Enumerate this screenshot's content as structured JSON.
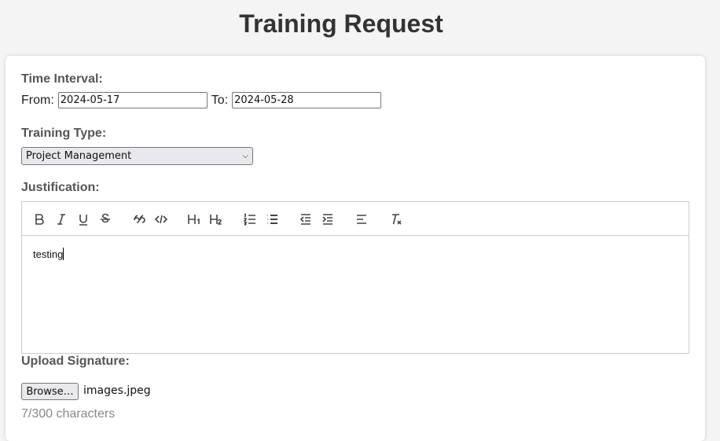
{
  "page": {
    "title": "Training Request"
  },
  "time_interval": {
    "label": "Time Interval:",
    "from_label": "From:",
    "from_value": "2024-05-17",
    "to_label": "To:",
    "to_value": "2024-05-28"
  },
  "training_type": {
    "label": "Training Type:",
    "selected": "Project Management"
  },
  "justification": {
    "label": "Justification:",
    "toolbar": [
      "bold",
      "italic",
      "underline",
      "strikethrough",
      "blockquote",
      "code-block",
      "header-1",
      "header-2",
      "ordered-list",
      "bullet-list",
      "outdent",
      "indent",
      "align",
      "clean"
    ],
    "text": "testing"
  },
  "signature": {
    "label": "Upload Signature:",
    "browse_label": "Browse…",
    "file_name": "images.jpeg"
  },
  "char_counter": "7/300 characters"
}
